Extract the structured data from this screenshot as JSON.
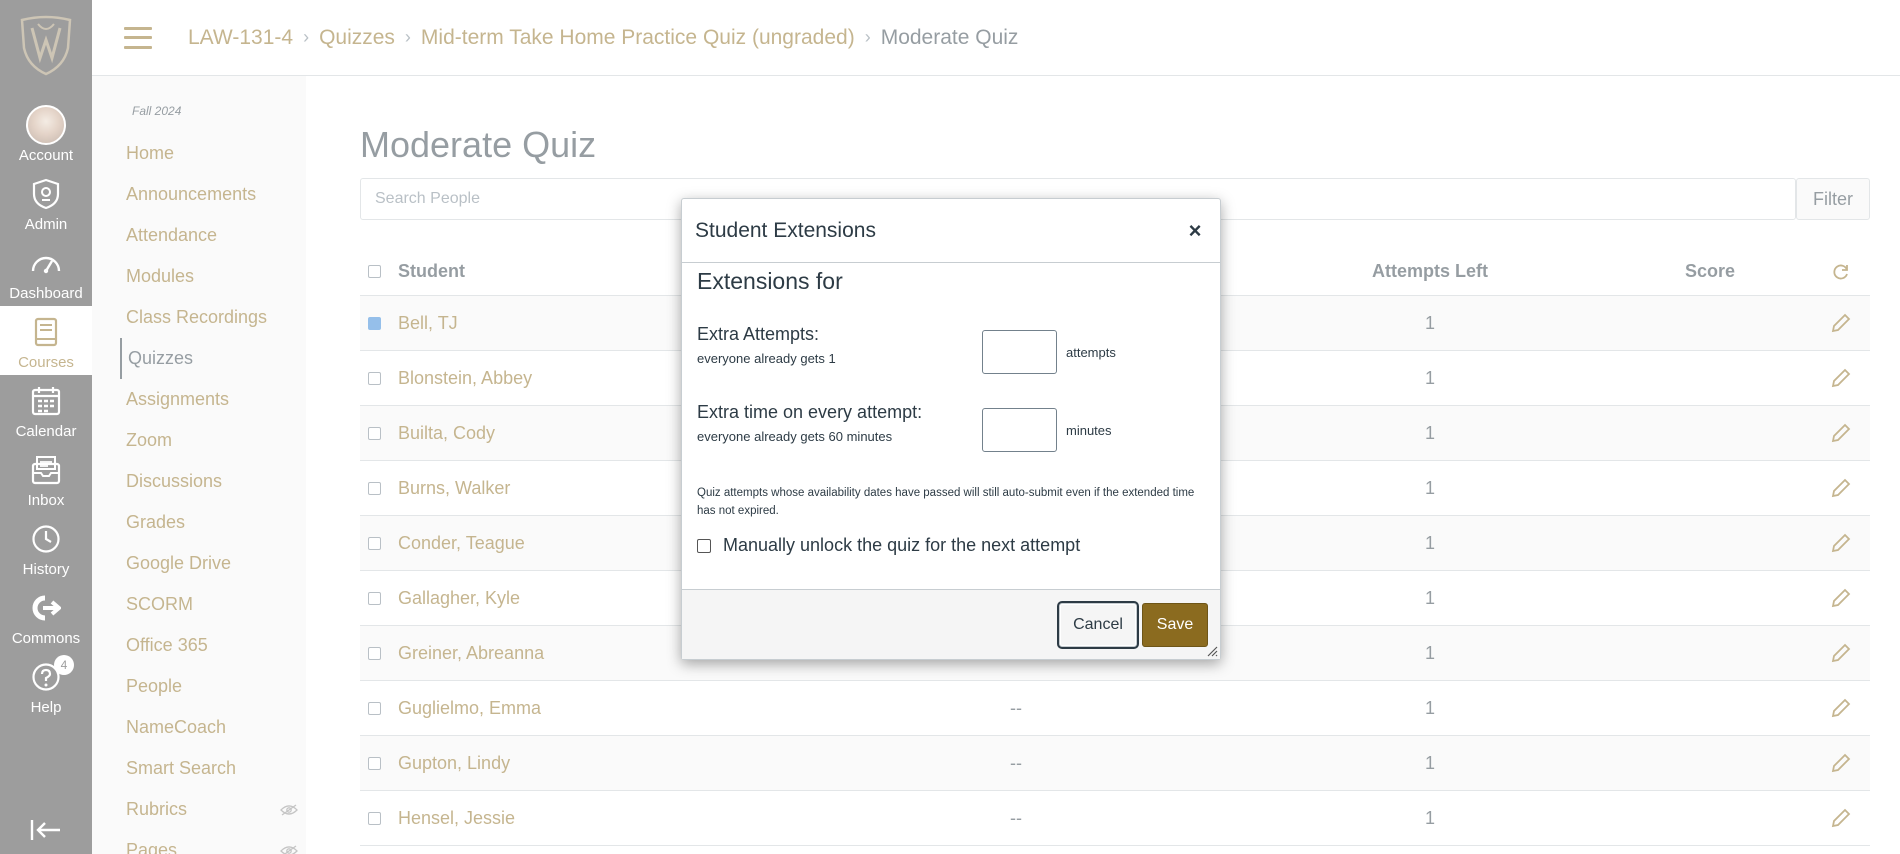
{
  "colors": {
    "brand": "#8b6b1f",
    "nav_bg": "#3b3b3b",
    "text": "#2d3b45",
    "border": "#c7cdd1"
  },
  "global_nav": {
    "items": [
      {
        "label": "Account",
        "icon": "avatar-icon"
      },
      {
        "label": "Admin",
        "icon": "shield-icon"
      },
      {
        "label": "Dashboard",
        "icon": "dashboard-icon"
      },
      {
        "label": "Courses",
        "icon": "book-icon"
      },
      {
        "label": "Calendar",
        "icon": "calendar-icon"
      },
      {
        "label": "Inbox",
        "icon": "inbox-icon"
      },
      {
        "label": "History",
        "icon": "clock-icon"
      },
      {
        "label": "Commons",
        "icon": "commons-icon"
      },
      {
        "label": "Help",
        "icon": "help-icon"
      }
    ],
    "help_badge": "4"
  },
  "breadcrumb": {
    "items": [
      "LAW-131-4",
      "Quizzes",
      "Mid-term Take Home Practice Quiz (ungraded)"
    ],
    "current": "Moderate Quiz"
  },
  "course_nav": {
    "term": "Fall 2024",
    "items": [
      "Home",
      "Announcements",
      "Attendance",
      "Modules",
      "Class Recordings",
      "Quizzes",
      "Assignments",
      "Zoom",
      "Discussions",
      "Grades",
      "Google Drive",
      "SCORM",
      "Office 365",
      "People",
      "NameCoach",
      "Smart Search",
      "Rubrics",
      "Pages"
    ],
    "active": "Quizzes"
  },
  "main": {
    "title": "Moderate Quiz",
    "search_placeholder": "Search People",
    "filter_label": "Filter",
    "columns": {
      "student": "Student",
      "attempts_left": "Attempts Left",
      "score": "Score"
    },
    "rows": [
      {
        "name": "Bell, TJ",
        "mid": "",
        "attempts": "1",
        "checked": true
      },
      {
        "name": "Blonstein, Abbey",
        "mid": "",
        "attempts": "1",
        "checked": false
      },
      {
        "name": "Builta, Cody",
        "mid": "",
        "attempts": "1",
        "checked": false
      },
      {
        "name": "Burns, Walker",
        "mid": "",
        "attempts": "1",
        "checked": false
      },
      {
        "name": "Conder, Teague",
        "mid": "",
        "attempts": "1",
        "checked": false
      },
      {
        "name": "Gallagher, Kyle",
        "mid": "",
        "attempts": "1",
        "checked": false
      },
      {
        "name": "Greiner, Abreanna",
        "mid": "",
        "attempts": "1",
        "checked": false
      },
      {
        "name": "Guglielmo, Emma",
        "mid": "--",
        "attempts": "1",
        "checked": false
      },
      {
        "name": "Gupton, Lindy",
        "mid": "--",
        "attempts": "1",
        "checked": false
      },
      {
        "name": "Hensel, Jessie",
        "mid": "--",
        "attempts": "1",
        "checked": false
      }
    ]
  },
  "dialog": {
    "title": "Student Extensions",
    "extensions_for": "Extensions for",
    "extra_attempts_label": "Extra Attempts:",
    "extra_attempts_sub": "everyone already gets 1",
    "extra_attempts_value": "",
    "extra_attempts_unit": "attempts",
    "extra_time_label": "Extra time on every attempt:",
    "extra_time_sub": "everyone already gets 60 minutes",
    "extra_time_value": "",
    "extra_time_unit": "minutes",
    "note": "Quiz attempts whose availability dates have passed will still auto-submit even if the extended time has not expired.",
    "unlock_label": "Manually unlock the quiz for the next attempt",
    "cancel_label": "Cancel",
    "save_label": "Save"
  }
}
